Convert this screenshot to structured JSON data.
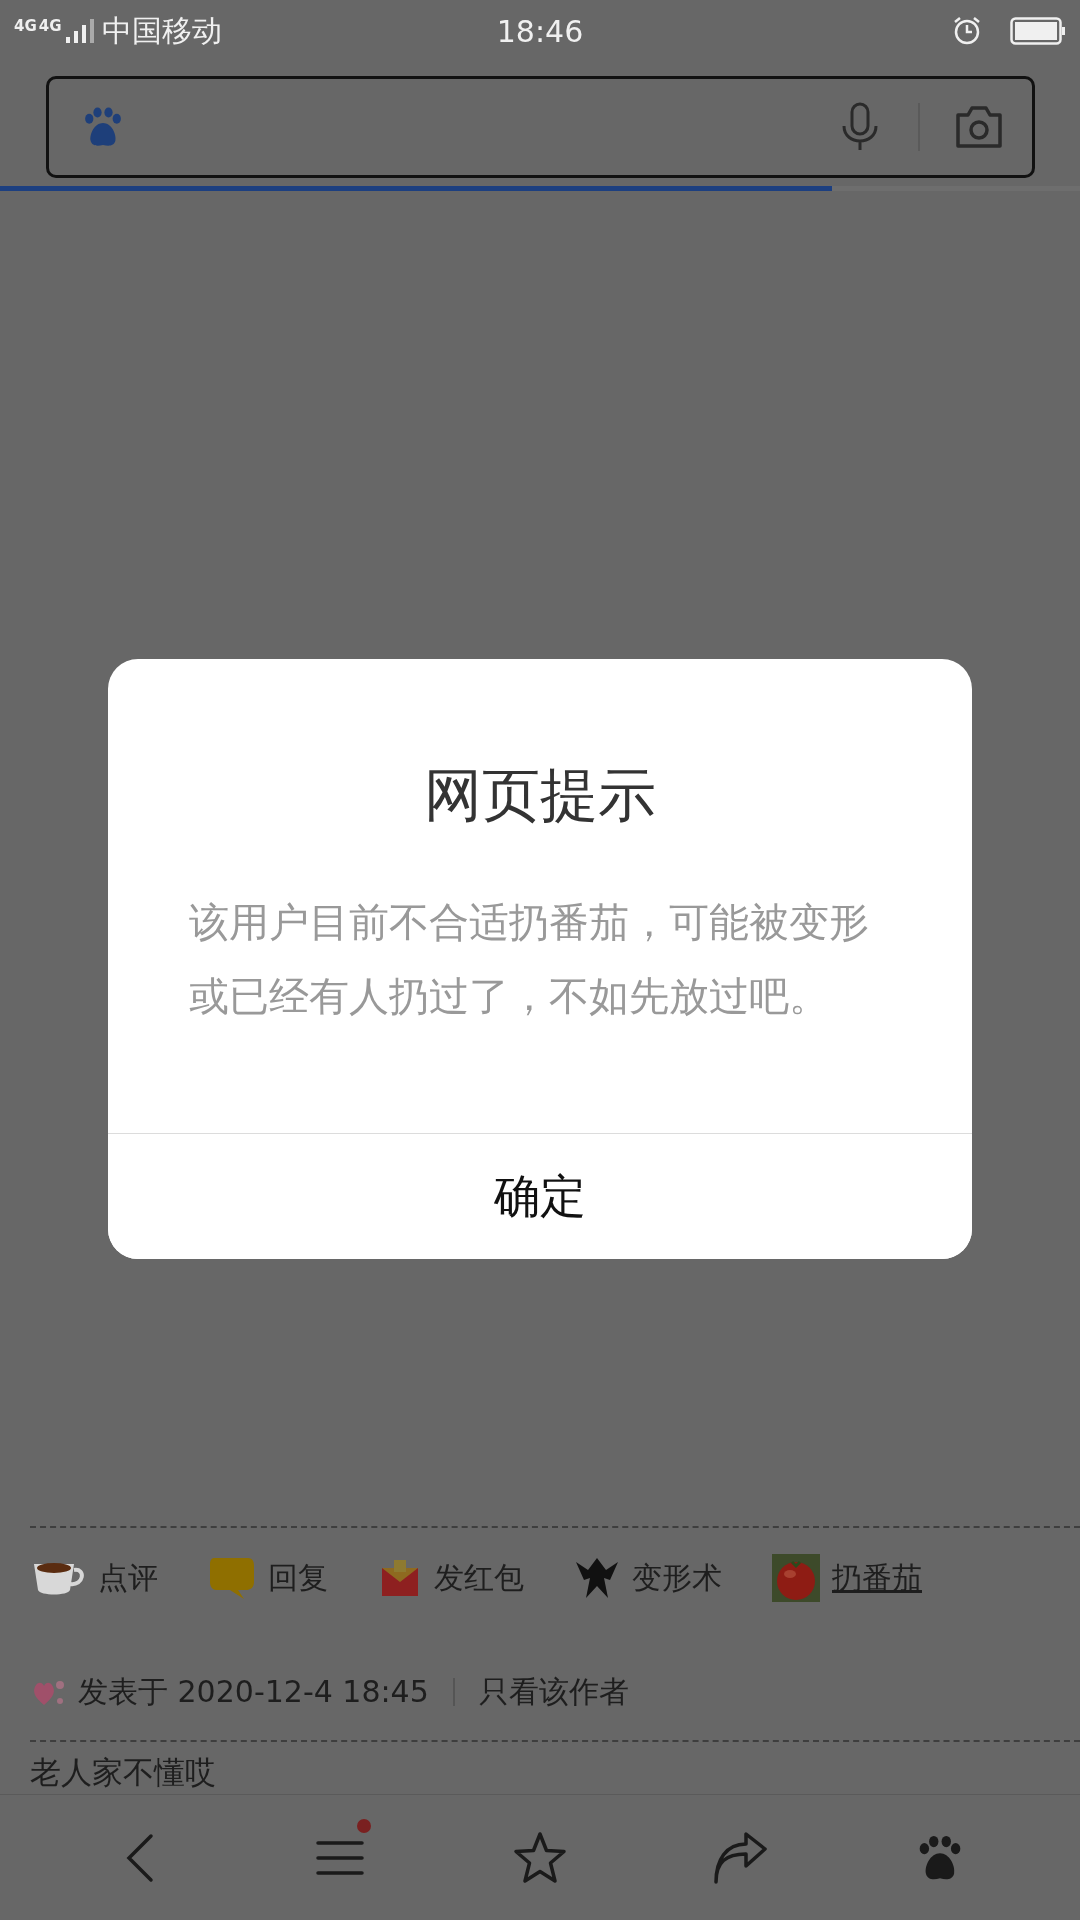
{
  "status_bar": {
    "network_labels": [
      "4G",
      "4G"
    ],
    "carrier": "中国移动",
    "time": "18:46"
  },
  "page_load": {
    "level": 0.77
  },
  "post": {
    "actions": [
      {
        "kind": "cup",
        "label": "点评",
        "link": false
      },
      {
        "kind": "bubble",
        "label": "回复",
        "link": false
      },
      {
        "kind": "envelope",
        "label": "发红包",
        "link": false
      },
      {
        "kind": "figure",
        "label": "变形术",
        "link": false
      },
      {
        "kind": "tomato",
        "label": "扔番茄",
        "link": true
      }
    ],
    "posted": "发表于 2020-12-4 18:45",
    "author_only": "只看该作者",
    "reply_preview": "老人家不懂哎"
  },
  "bottom_bar": {
    "items": [
      {
        "kind": "back",
        "badge": false
      },
      {
        "kind": "menu",
        "badge": true
      },
      {
        "kind": "star",
        "badge": false
      },
      {
        "kind": "share",
        "badge": false
      },
      {
        "kind": "paw",
        "badge": false
      }
    ]
  },
  "dialog": {
    "title": "网页提示",
    "message": "该用户目前不合适扔番茄，可能被变形或已经有人扔过了，不如先放过吧。",
    "button": "确定"
  }
}
